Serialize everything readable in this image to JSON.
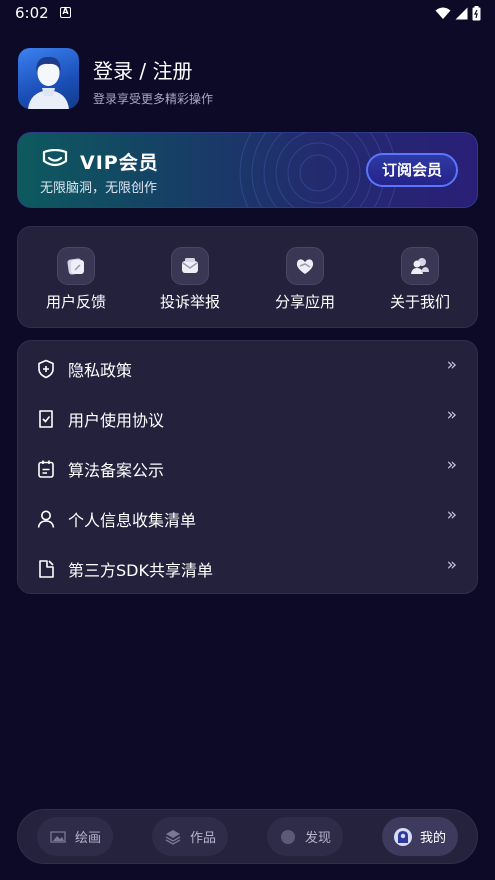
{
  "status_bar": {
    "time": "6:02",
    "badge": "A"
  },
  "profile": {
    "title": "登录 / 注册",
    "subtitle": "登录享受更多精彩操作"
  },
  "vip": {
    "title": "VIP会员",
    "subtitle": "无限脑洞，无限创作",
    "button": "订阅会员"
  },
  "quick_actions": [
    {
      "label": "用户反馈",
      "icon": "feedback-icon"
    },
    {
      "label": "投诉举报",
      "icon": "complaint-icon"
    },
    {
      "label": "分享应用",
      "icon": "share-icon"
    },
    {
      "label": "关于我们",
      "icon": "about-icon"
    }
  ],
  "menu": [
    {
      "label": "隐私政策",
      "icon": "shield-icon"
    },
    {
      "label": "用户使用协议",
      "icon": "document-check-icon"
    },
    {
      "label": "算法备案公示",
      "icon": "calendar-icon"
    },
    {
      "label": "个人信息收集清单",
      "icon": "person-icon"
    },
    {
      "label": "第三方SDK共享清单",
      "icon": "file-icon"
    }
  ],
  "menu_arrow": "»",
  "tabs": [
    {
      "label": "绘画",
      "icon": "image-icon",
      "active": false
    },
    {
      "label": "作品",
      "icon": "layers-icon",
      "active": false
    },
    {
      "label": "发现",
      "icon": "compass-icon",
      "active": false
    },
    {
      "label": "我的",
      "icon": "profile-icon",
      "active": true
    }
  ],
  "colors": {
    "background": "#0c0a26",
    "card": "#24213d",
    "vip_button_border": "#5a76ff",
    "avatar_blue": "#2f6fe0"
  }
}
